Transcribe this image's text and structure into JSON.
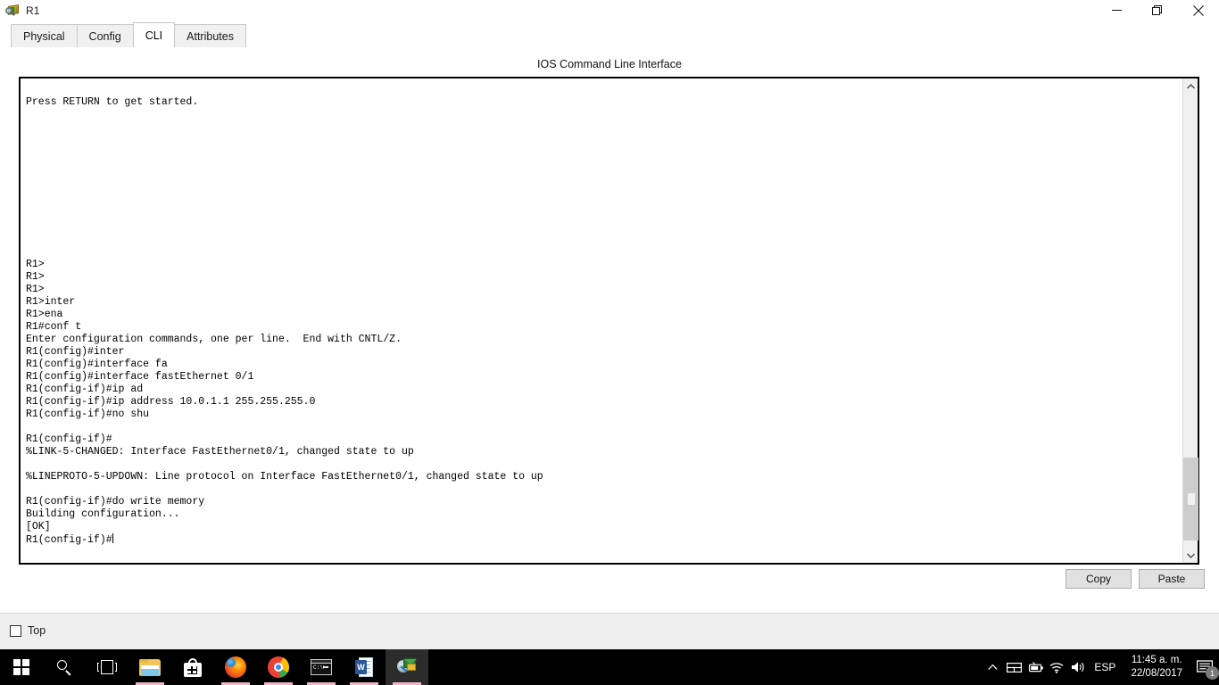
{
  "window": {
    "title": "R1",
    "icon": "packet-tracer-router-icon",
    "controls": {
      "minimize": "—",
      "restore": "❐",
      "close": "✕"
    }
  },
  "tabs": [
    {
      "label": "Physical",
      "active": false
    },
    {
      "label": "Config",
      "active": false
    },
    {
      "label": "CLI",
      "active": true
    },
    {
      "label": "Attributes",
      "active": false
    }
  ],
  "panel": {
    "heading": "IOS Command Line Interface"
  },
  "terminal": {
    "lines": [
      "",
      "Press RETURN to get started.",
      "",
      "",
      "",
      "",
      "",
      "",
      "",
      "",
      "",
      "",
      "",
      "",
      "R1>",
      "R1>",
      "R1>",
      "R1>inter",
      "R1>ena",
      "R1#conf t",
      "Enter configuration commands, one per line.  End with CNTL/Z.",
      "R1(config)#inter",
      "R1(config)#interface fa",
      "R1(config)#interface fastEthernet 0/1",
      "R1(config-if)#ip ad",
      "R1(config-if)#ip address 10.0.1.1 255.255.255.0",
      "R1(config-if)#no shu",
      "",
      "R1(config-if)#",
      "%LINK-5-CHANGED: Interface FastEthernet0/1, changed state to up",
      "",
      "%LINEPROTO-5-UPDOWN: Line protocol on Interface FastEthernet0/1, changed state to up",
      "",
      "R1(config-if)#do write memory",
      "Building configuration...",
      "[OK]"
    ],
    "prompt": "R1(config-if)#",
    "scrollbar": {
      "up_arrow": "⌃",
      "down_arrow": "⌄"
    }
  },
  "actions": {
    "copy_label": "Copy",
    "paste_label": "Paste"
  },
  "bottom": {
    "top_checkbox_label": "Top",
    "top_checkbox_checked": false
  },
  "taskbar": {
    "items": [
      {
        "name": "start-button",
        "icon": "windows-logo-icon",
        "active": false,
        "running": false
      },
      {
        "name": "search-button",
        "icon": "search-icon",
        "active": false,
        "running": false
      },
      {
        "name": "task-view-button",
        "icon": "task-view-icon",
        "active": false,
        "running": false
      },
      {
        "name": "file-explorer",
        "icon": "folder-icon",
        "active": false,
        "running": true
      },
      {
        "name": "microsoft-store",
        "icon": "store-bag-icon",
        "active": false,
        "running": false
      },
      {
        "name": "firefox",
        "icon": "firefox-icon",
        "active": false,
        "running": true
      },
      {
        "name": "google-chrome",
        "icon": "chrome-icon",
        "active": false,
        "running": true
      },
      {
        "name": "command-prompt",
        "icon": "command-prompt-icon",
        "active": false,
        "running": true
      },
      {
        "name": "microsoft-word",
        "icon": "word-icon",
        "active": false,
        "running": true
      },
      {
        "name": "packet-tracer",
        "icon": "packet-tracer-icon",
        "active": true,
        "running": true
      }
    ],
    "tray": {
      "show_hidden": "∧",
      "network_icon": "network-icon",
      "battery_icon": "battery-icon",
      "wifi_icon": "wifi-icon",
      "volume_icon": "volume-icon",
      "language": "ESP",
      "time": "11:45 a. m.",
      "date": "22/08/2017",
      "action_center_icon": "action-center-icon",
      "notification_count": "1"
    }
  },
  "word_icon_letter": "W",
  "cmd_icon_text": "C:\\>"
}
